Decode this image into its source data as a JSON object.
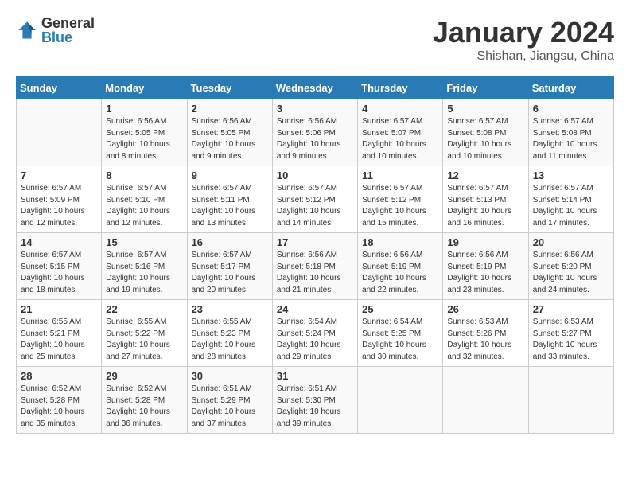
{
  "header": {
    "logo": {
      "general": "General",
      "blue": "Blue"
    },
    "title": "January 2024",
    "location": "Shishan, Jiangsu, China"
  },
  "columns": [
    "Sunday",
    "Monday",
    "Tuesday",
    "Wednesday",
    "Thursday",
    "Friday",
    "Saturday"
  ],
  "weeks": [
    [
      {
        "day": "",
        "info": ""
      },
      {
        "day": "1",
        "info": "Sunrise: 6:56 AM\nSunset: 5:05 PM\nDaylight: 10 hours\nand 8 minutes."
      },
      {
        "day": "2",
        "info": "Sunrise: 6:56 AM\nSunset: 5:05 PM\nDaylight: 10 hours\nand 9 minutes."
      },
      {
        "day": "3",
        "info": "Sunrise: 6:56 AM\nSunset: 5:06 PM\nDaylight: 10 hours\nand 9 minutes."
      },
      {
        "day": "4",
        "info": "Sunrise: 6:57 AM\nSunset: 5:07 PM\nDaylight: 10 hours\nand 10 minutes."
      },
      {
        "day": "5",
        "info": "Sunrise: 6:57 AM\nSunset: 5:08 PM\nDaylight: 10 hours\nand 10 minutes."
      },
      {
        "day": "6",
        "info": "Sunrise: 6:57 AM\nSunset: 5:08 PM\nDaylight: 10 hours\nand 11 minutes."
      }
    ],
    [
      {
        "day": "7",
        "info": "Sunrise: 6:57 AM\nSunset: 5:09 PM\nDaylight: 10 hours\nand 12 minutes."
      },
      {
        "day": "8",
        "info": "Sunrise: 6:57 AM\nSunset: 5:10 PM\nDaylight: 10 hours\nand 12 minutes."
      },
      {
        "day": "9",
        "info": "Sunrise: 6:57 AM\nSunset: 5:11 PM\nDaylight: 10 hours\nand 13 minutes."
      },
      {
        "day": "10",
        "info": "Sunrise: 6:57 AM\nSunset: 5:12 PM\nDaylight: 10 hours\nand 14 minutes."
      },
      {
        "day": "11",
        "info": "Sunrise: 6:57 AM\nSunset: 5:12 PM\nDaylight: 10 hours\nand 15 minutes."
      },
      {
        "day": "12",
        "info": "Sunrise: 6:57 AM\nSunset: 5:13 PM\nDaylight: 10 hours\nand 16 minutes."
      },
      {
        "day": "13",
        "info": "Sunrise: 6:57 AM\nSunset: 5:14 PM\nDaylight: 10 hours\nand 17 minutes."
      }
    ],
    [
      {
        "day": "14",
        "info": "Sunrise: 6:57 AM\nSunset: 5:15 PM\nDaylight: 10 hours\nand 18 minutes."
      },
      {
        "day": "15",
        "info": "Sunrise: 6:57 AM\nSunset: 5:16 PM\nDaylight: 10 hours\nand 19 minutes."
      },
      {
        "day": "16",
        "info": "Sunrise: 6:57 AM\nSunset: 5:17 PM\nDaylight: 10 hours\nand 20 minutes."
      },
      {
        "day": "17",
        "info": "Sunrise: 6:56 AM\nSunset: 5:18 PM\nDaylight: 10 hours\nand 21 minutes."
      },
      {
        "day": "18",
        "info": "Sunrise: 6:56 AM\nSunset: 5:19 PM\nDaylight: 10 hours\nand 22 minutes."
      },
      {
        "day": "19",
        "info": "Sunrise: 6:56 AM\nSunset: 5:19 PM\nDaylight: 10 hours\nand 23 minutes."
      },
      {
        "day": "20",
        "info": "Sunrise: 6:56 AM\nSunset: 5:20 PM\nDaylight: 10 hours\nand 24 minutes."
      }
    ],
    [
      {
        "day": "21",
        "info": "Sunrise: 6:55 AM\nSunset: 5:21 PM\nDaylight: 10 hours\nand 25 minutes."
      },
      {
        "day": "22",
        "info": "Sunrise: 6:55 AM\nSunset: 5:22 PM\nDaylight: 10 hours\nand 27 minutes."
      },
      {
        "day": "23",
        "info": "Sunrise: 6:55 AM\nSunset: 5:23 PM\nDaylight: 10 hours\nand 28 minutes."
      },
      {
        "day": "24",
        "info": "Sunrise: 6:54 AM\nSunset: 5:24 PM\nDaylight: 10 hours\nand 29 minutes."
      },
      {
        "day": "25",
        "info": "Sunrise: 6:54 AM\nSunset: 5:25 PM\nDaylight: 10 hours\nand 30 minutes."
      },
      {
        "day": "26",
        "info": "Sunrise: 6:53 AM\nSunset: 5:26 PM\nDaylight: 10 hours\nand 32 minutes."
      },
      {
        "day": "27",
        "info": "Sunrise: 6:53 AM\nSunset: 5:27 PM\nDaylight: 10 hours\nand 33 minutes."
      }
    ],
    [
      {
        "day": "28",
        "info": "Sunrise: 6:52 AM\nSunset: 5:28 PM\nDaylight: 10 hours\nand 35 minutes."
      },
      {
        "day": "29",
        "info": "Sunrise: 6:52 AM\nSunset: 5:28 PM\nDaylight: 10 hours\nand 36 minutes."
      },
      {
        "day": "30",
        "info": "Sunrise: 6:51 AM\nSunset: 5:29 PM\nDaylight: 10 hours\nand 37 minutes."
      },
      {
        "day": "31",
        "info": "Sunrise: 6:51 AM\nSunset: 5:30 PM\nDaylight: 10 hours\nand 39 minutes."
      },
      {
        "day": "",
        "info": ""
      },
      {
        "day": "",
        "info": ""
      },
      {
        "day": "",
        "info": ""
      }
    ]
  ]
}
